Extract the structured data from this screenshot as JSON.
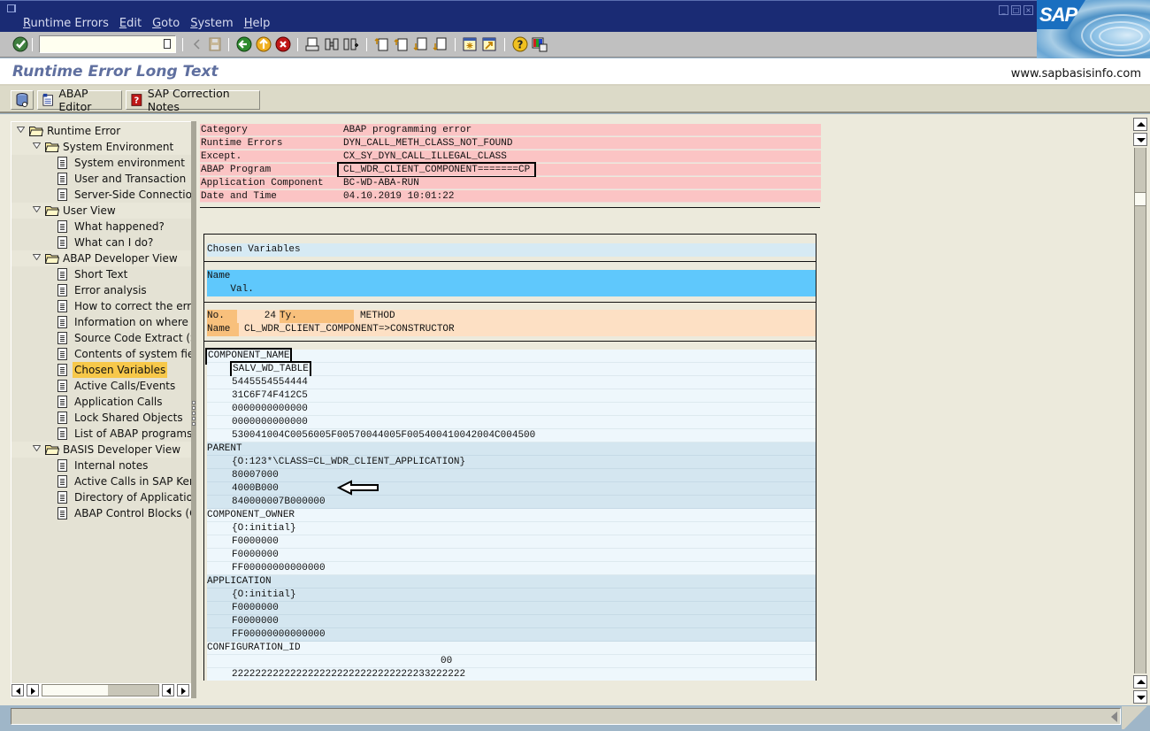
{
  "menubar": {
    "items": [
      "Runtime Errors",
      "Edit",
      "Goto",
      "System",
      "Help"
    ]
  },
  "window_controls": {
    "minimize": "minimize-icon",
    "maximize": "maximize-icon",
    "close": "close-icon"
  },
  "brand": {
    "logo_text": "SAP"
  },
  "toolbar": {
    "command_field_value": "",
    "icons": [
      "enter-icon",
      "command-dropdown-icon",
      "back-arrow-icon",
      "save-icon",
      "back-icon",
      "exit-icon",
      "cancel-icon",
      "print-icon",
      "find-icon",
      "find-next-icon",
      "first-page-icon",
      "previous-page-icon",
      "next-page-icon",
      "last-page-icon",
      "create-session-icon",
      "shortcut-icon",
      "help-icon",
      "customize-layout-icon"
    ]
  },
  "title_area": {
    "title": "Runtime Error Long Text",
    "website": "www.sapbasisinfo.com"
  },
  "app_toolbar": {
    "buttons": [
      {
        "label": "",
        "icon": "database-icon"
      },
      {
        "label": "ABAP Editor",
        "icon": "abap-editor-icon"
      },
      {
        "label": "SAP Correction Notes",
        "icon": "correction-notes-icon"
      }
    ]
  },
  "tree": {
    "nodes": [
      {
        "label": "Runtime Error",
        "type": "folder",
        "level": 0
      },
      {
        "label": "System Environment",
        "type": "folder",
        "level": 1
      },
      {
        "label": "System environment",
        "type": "doc",
        "level": 2
      },
      {
        "label": "User and Transaction",
        "type": "doc",
        "level": 2
      },
      {
        "label": "Server-Side Connection",
        "type": "doc",
        "level": 2
      },
      {
        "label": "User View",
        "type": "folder",
        "level": 1
      },
      {
        "label": "What happened?",
        "type": "doc",
        "level": 2
      },
      {
        "label": "What can I do?",
        "type": "doc",
        "level": 2
      },
      {
        "label": "ABAP Developer View",
        "type": "folder",
        "level": 1
      },
      {
        "label": "Short Text",
        "type": "doc",
        "level": 2
      },
      {
        "label": "Error analysis",
        "type": "doc",
        "level": 2
      },
      {
        "label": "How to correct the erro",
        "type": "doc",
        "level": 2
      },
      {
        "label": "Information on where te",
        "type": "doc",
        "level": 2
      },
      {
        "label": "Source Code Extract (Sc",
        "type": "doc",
        "level": 2
      },
      {
        "label": "Contents of system field",
        "type": "doc",
        "level": 2
      },
      {
        "label": "Chosen Variables",
        "type": "doc",
        "level": 2,
        "selected": true
      },
      {
        "label": "Active Calls/Events",
        "type": "doc",
        "level": 2
      },
      {
        "label": "Application Calls",
        "type": "doc",
        "level": 2
      },
      {
        "label": "Lock Shared Objects",
        "type": "doc",
        "level": 2
      },
      {
        "label": "List of ABAP programs a",
        "type": "doc",
        "level": 2
      },
      {
        "label": "BASIS Developer View",
        "type": "folder",
        "level": 1
      },
      {
        "label": "Internal notes",
        "type": "doc",
        "level": 2
      },
      {
        "label": "Active Calls in SAP Kerne",
        "type": "doc",
        "level": 2
      },
      {
        "label": "Directory of Application",
        "type": "doc",
        "level": 2
      },
      {
        "label": "ABAP Control Blocks (CC",
        "type": "doc",
        "level": 2
      }
    ]
  },
  "header_info": [
    {
      "key": "Category",
      "value": "ABAP programming error"
    },
    {
      "key": "Runtime Errors",
      "value": "DYN_CALL_METH_CLASS_NOT_FOUND"
    },
    {
      "key": "Except.",
      "value": "CX_SY_DYN_CALL_ILLEGAL_CLASS"
    },
    {
      "key": "ABAP Program",
      "value": "CL_WDR_CLIENT_COMPONENT=======CP",
      "highlighted": true
    },
    {
      "key": "Application Component",
      "value": "BC-WD-ABA-RUN"
    },
    {
      "key": "Date and Time",
      "value": "04.10.2019 10:01:22"
    }
  ],
  "chosen_variables": {
    "title": "Chosen Variables",
    "col_header_name": "Name",
    "col_header_val": "    Val.",
    "no_label": "No.",
    "no_value": "24",
    "ty_label": "Ty.",
    "ty_value": "METHOD",
    "name_label": "Name",
    "name_value": "CL_WDR_CLIENT_COMPONENT=>CONSTRUCTOR",
    "rows": [
      {
        "text": "COMPONENT_NAME",
        "indent": false,
        "style": "light",
        "highlighted": true
      },
      {
        "text": "SALV_WD_TABLE",
        "indent": true,
        "style": "light",
        "highlighted": true,
        "arrow": true
      },
      {
        "text": "5445554554444",
        "indent": true,
        "style": "light"
      },
      {
        "text": "31C6F74F412C5",
        "indent": true,
        "style": "light"
      },
      {
        "text": "0000000000000",
        "indent": true,
        "style": "light"
      },
      {
        "text": "0000000000000",
        "indent": true,
        "style": "light"
      },
      {
        "text": "530041004C0056005F00570044005F005400410042004C004500",
        "indent": true,
        "style": "light"
      },
      {
        "text": "PARENT",
        "indent": false,
        "style": "mid"
      },
      {
        "text": "{O:123*\\CLASS=CL_WDR_CLIENT_APPLICATION}",
        "indent": true,
        "style": "mid"
      },
      {
        "text": "80007000",
        "indent": true,
        "style": "mid"
      },
      {
        "text": "4000B000",
        "indent": true,
        "style": "mid"
      },
      {
        "text": "840000007B000000",
        "indent": true,
        "style": "mid"
      },
      {
        "text": "COMPONENT_OWNER",
        "indent": false,
        "style": "light"
      },
      {
        "text": "{O:initial}",
        "indent": true,
        "style": "light"
      },
      {
        "text": "F0000000",
        "indent": true,
        "style": "light"
      },
      {
        "text": "F0000000",
        "indent": true,
        "style": "light"
      },
      {
        "text": "FF00000000000000",
        "indent": true,
        "style": "light"
      },
      {
        "text": "APPLICATION",
        "indent": false,
        "style": "mid"
      },
      {
        "text": "{O:initial}",
        "indent": true,
        "style": "mid"
      },
      {
        "text": "F0000000",
        "indent": true,
        "style": "mid"
      },
      {
        "text": "F0000000",
        "indent": true,
        "style": "mid"
      },
      {
        "text": "FF00000000000000",
        "indent": true,
        "style": "mid"
      },
      {
        "text": "CONFIGURATION_ID",
        "indent": false,
        "style": "light"
      },
      {
        "text": "                                        00",
        "indent": false,
        "style": "light"
      },
      {
        "text": "2222222222222222222222222222222233222222",
        "indent": true,
        "style": "light"
      }
    ]
  },
  "status_bar": {
    "message": ""
  },
  "colors": {
    "title_bar": "#1a2b74",
    "header_rows": "#fbc4c4",
    "column_header": "#5fc8fc",
    "method_row": "#fde0c4",
    "selected_tree_item": "#f7c84a"
  }
}
